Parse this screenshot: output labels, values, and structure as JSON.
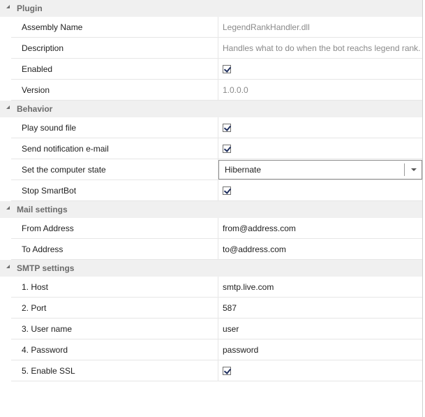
{
  "categories": [
    {
      "title": "Plugin",
      "rows": [
        {
          "name": "Assembly Name",
          "value": "LegendRankHandler.dll",
          "kind": "text",
          "readonly": true
        },
        {
          "name": "Description",
          "value": "Handles what to do when the bot reachs legend rank.",
          "kind": "text",
          "readonly": true
        },
        {
          "name": "Enabled",
          "checked": true,
          "kind": "check"
        },
        {
          "name": "Version",
          "value": "1.0.0.0",
          "kind": "text",
          "readonly": true
        }
      ]
    },
    {
      "title": "Behavior",
      "rows": [
        {
          "name": "Play sound file",
          "checked": true,
          "kind": "check"
        },
        {
          "name": "Send notification e-mail",
          "checked": true,
          "kind": "check"
        },
        {
          "name": "Set the computer state",
          "value": "Hibernate",
          "kind": "combo"
        },
        {
          "name": "Stop SmartBot",
          "checked": true,
          "kind": "check"
        }
      ]
    },
    {
      "title": "Mail settings",
      "rows": [
        {
          "name": "From Address",
          "value": "from@address.com",
          "kind": "text"
        },
        {
          "name": "To Address",
          "value": "to@address.com",
          "kind": "text"
        }
      ]
    },
    {
      "title": "SMTP settings",
      "rows": [
        {
          "name": "1. Host",
          "value": "smtp.live.com",
          "kind": "text"
        },
        {
          "name": "2. Port",
          "value": "587",
          "kind": "text"
        },
        {
          "name": "3. User name",
          "value": "user",
          "kind": "text"
        },
        {
          "name": "4. Password",
          "value": "password",
          "kind": "text"
        },
        {
          "name": "5. Enable SSL",
          "checked": true,
          "kind": "check"
        }
      ]
    }
  ]
}
